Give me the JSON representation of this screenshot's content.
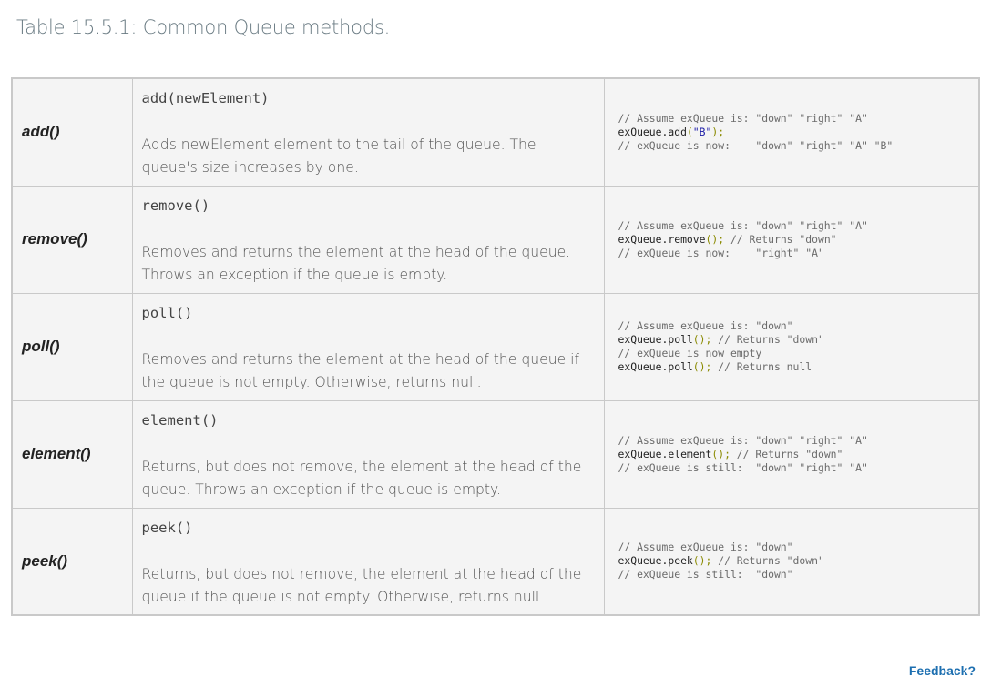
{
  "caption": "Table 15.5.1: Common Queue methods.",
  "rows": [
    {
      "name": "add()",
      "signature": "add(newElement)",
      "description": "Adds newElement element to the tail of the queue. The queue's size increases by one.",
      "code": {
        "line1": "// Assume exQueue is: \"down\" \"right\" \"A\"",
        "line2_obj": "exQueue.add",
        "line2_open": "(",
        "line2_str": "\"B\"",
        "line2_close": ");",
        "line3": "// exQueue is now:    \"down\" \"right\" \"A\" \"B\""
      }
    },
    {
      "name": "remove()",
      "signature": "remove()",
      "description": "Removes and returns the element at the head of the queue. Throws an exception if the queue is empty.",
      "code": {
        "line1": "// Assume exQueue is: \"down\" \"right\" \"A\"",
        "line2_obj": "exQueue.remove",
        "line2_paren": "();",
        "line2_comment": " // Returns \"down\"",
        "line3": "// exQueue is now:    \"right\" \"A\""
      }
    },
    {
      "name": "poll()",
      "signature": "poll()",
      "description": "Removes and returns the element at the head of the queue if the queue is not empty. Otherwise, returns null.",
      "code": {
        "line1": "// Assume exQueue is: \"down\"",
        "line2_obj": "exQueue.poll",
        "line2_paren": "();",
        "line2_comment": " // Returns \"down\"",
        "line3": "// exQueue is now empty",
        "line4_obj": "exQueue.poll",
        "line4_paren": "();",
        "line4_comment": " // Returns null"
      }
    },
    {
      "name": "element()",
      "signature": "element()",
      "description": "Returns, but does not remove, the element at the head of the queue. Throws an exception if the queue is empty.",
      "code": {
        "line1": "// Assume exQueue is: \"down\" \"right\" \"A\"",
        "line2_obj": "exQueue.element",
        "line2_paren": "();",
        "line2_comment": " // Returns \"down\"",
        "line3": "// exQueue is still:  \"down\" \"right\" \"A\""
      }
    },
    {
      "name": "peek()",
      "signature": "peek()",
      "description": "Returns, but does not remove, the element at the head of the queue if the queue is not empty. Otherwise, returns null.",
      "code": {
        "line1": "// Assume exQueue is: \"down\"",
        "line2_obj": "exQueue.peek",
        "line2_paren": "();",
        "line2_comment": " // Returns \"down\"",
        "line3": "// exQueue is still:  \"down\""
      }
    }
  ],
  "feedback_label": "Feedback?"
}
